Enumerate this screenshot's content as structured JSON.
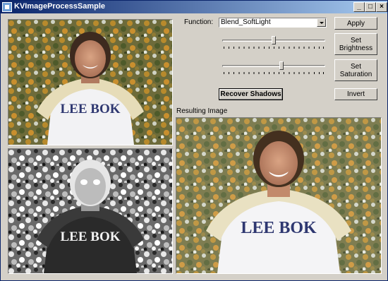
{
  "window": {
    "title": "KVImageProcessSample",
    "controls": {
      "minimize": "_",
      "maximize": "□",
      "close": "×"
    }
  },
  "controls": {
    "function_label": "Function:",
    "function_value": "Blend_SoftLight",
    "apply": "Apply",
    "set_brightness": "Set Brightness",
    "set_saturation": "Set Saturation",
    "recover_shadows": "Recover Shadows",
    "invert": "Invert",
    "brightness_level": 0.5,
    "saturation_level": 0.58
  },
  "result_label": "Resulting Image",
  "photo": {
    "shirt_text": "LEE BOK"
  },
  "colors": {
    "face_bg": "#d4d0c8",
    "title_start": "#0a246a",
    "title_end": "#a6caf0",
    "foliage": "#8a7a3a",
    "shirt": "#f2f2f4",
    "scarf": "#e6dcb8"
  }
}
